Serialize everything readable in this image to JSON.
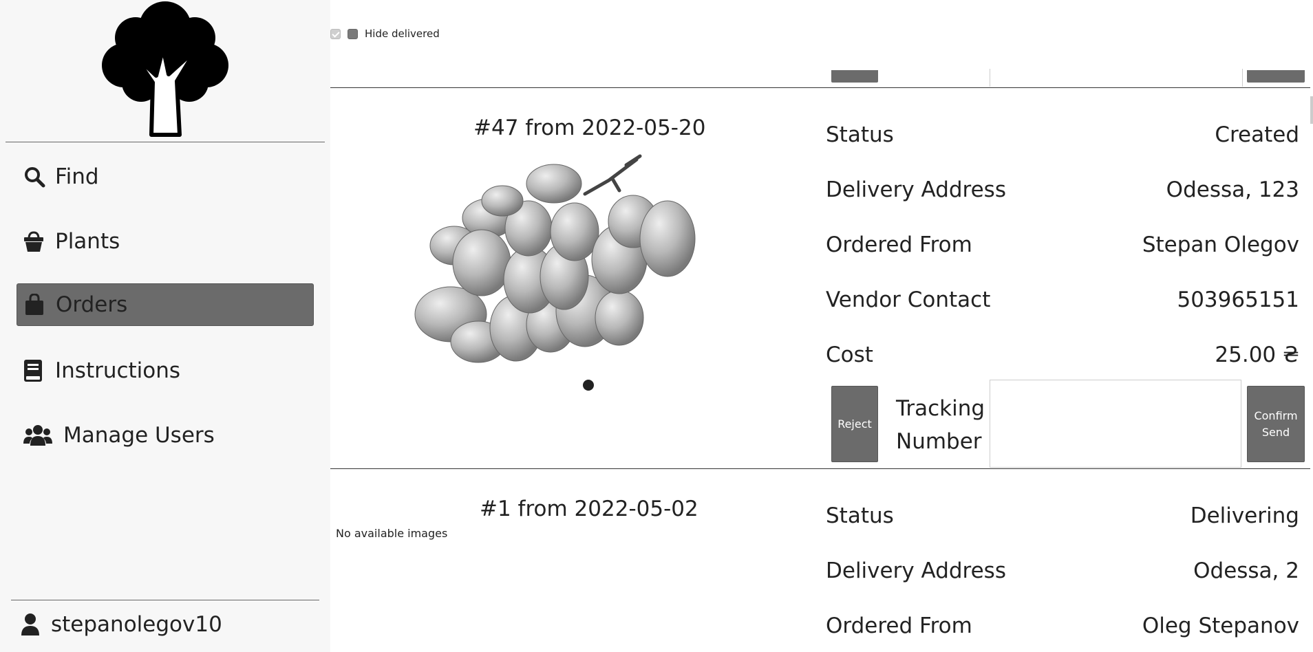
{
  "sidebar": {
    "items": [
      {
        "label": "Find",
        "icon": "search-icon"
      },
      {
        "label": "Plants",
        "icon": "basket-icon"
      },
      {
        "label": "Orders",
        "icon": "shopping-bag-icon",
        "active": true
      },
      {
        "label": "Instructions",
        "icon": "book-icon"
      },
      {
        "label": "Manage Users",
        "icon": "users-icon"
      }
    ],
    "username": "stepanolegov10"
  },
  "filter": {
    "hide_delivered_label": "Hide delivered"
  },
  "orders": [
    {
      "title": "#47 from 2022-05-20",
      "status_label": "Status",
      "status_value": "Created",
      "address_label": "Delivery Address",
      "address_value": "Odessa, 123",
      "from_label": "Ordered From",
      "from_value": "Stepan Olegov",
      "contact_label": "Vendor Contact",
      "contact_value": "503965151",
      "cost_label": "Cost",
      "cost_value": "25.00 ₴",
      "reject_label": "Reject",
      "tracking_label": "Tracking Number",
      "confirm_label": "Confirm Send"
    },
    {
      "title": "#1 from 2022-05-02",
      "no_images": "No available images",
      "status_label": "Status",
      "status_value": "Delivering",
      "address_label": "Delivery Address",
      "address_value": "Odessa, 2",
      "from_label": "Ordered From",
      "from_value": "Oleg Stepanov"
    }
  ],
  "colors": {
    "active_nav": "#6b6b6b",
    "button": "#6b6b6b",
    "sidebar_bg": "#f7f7f7"
  }
}
